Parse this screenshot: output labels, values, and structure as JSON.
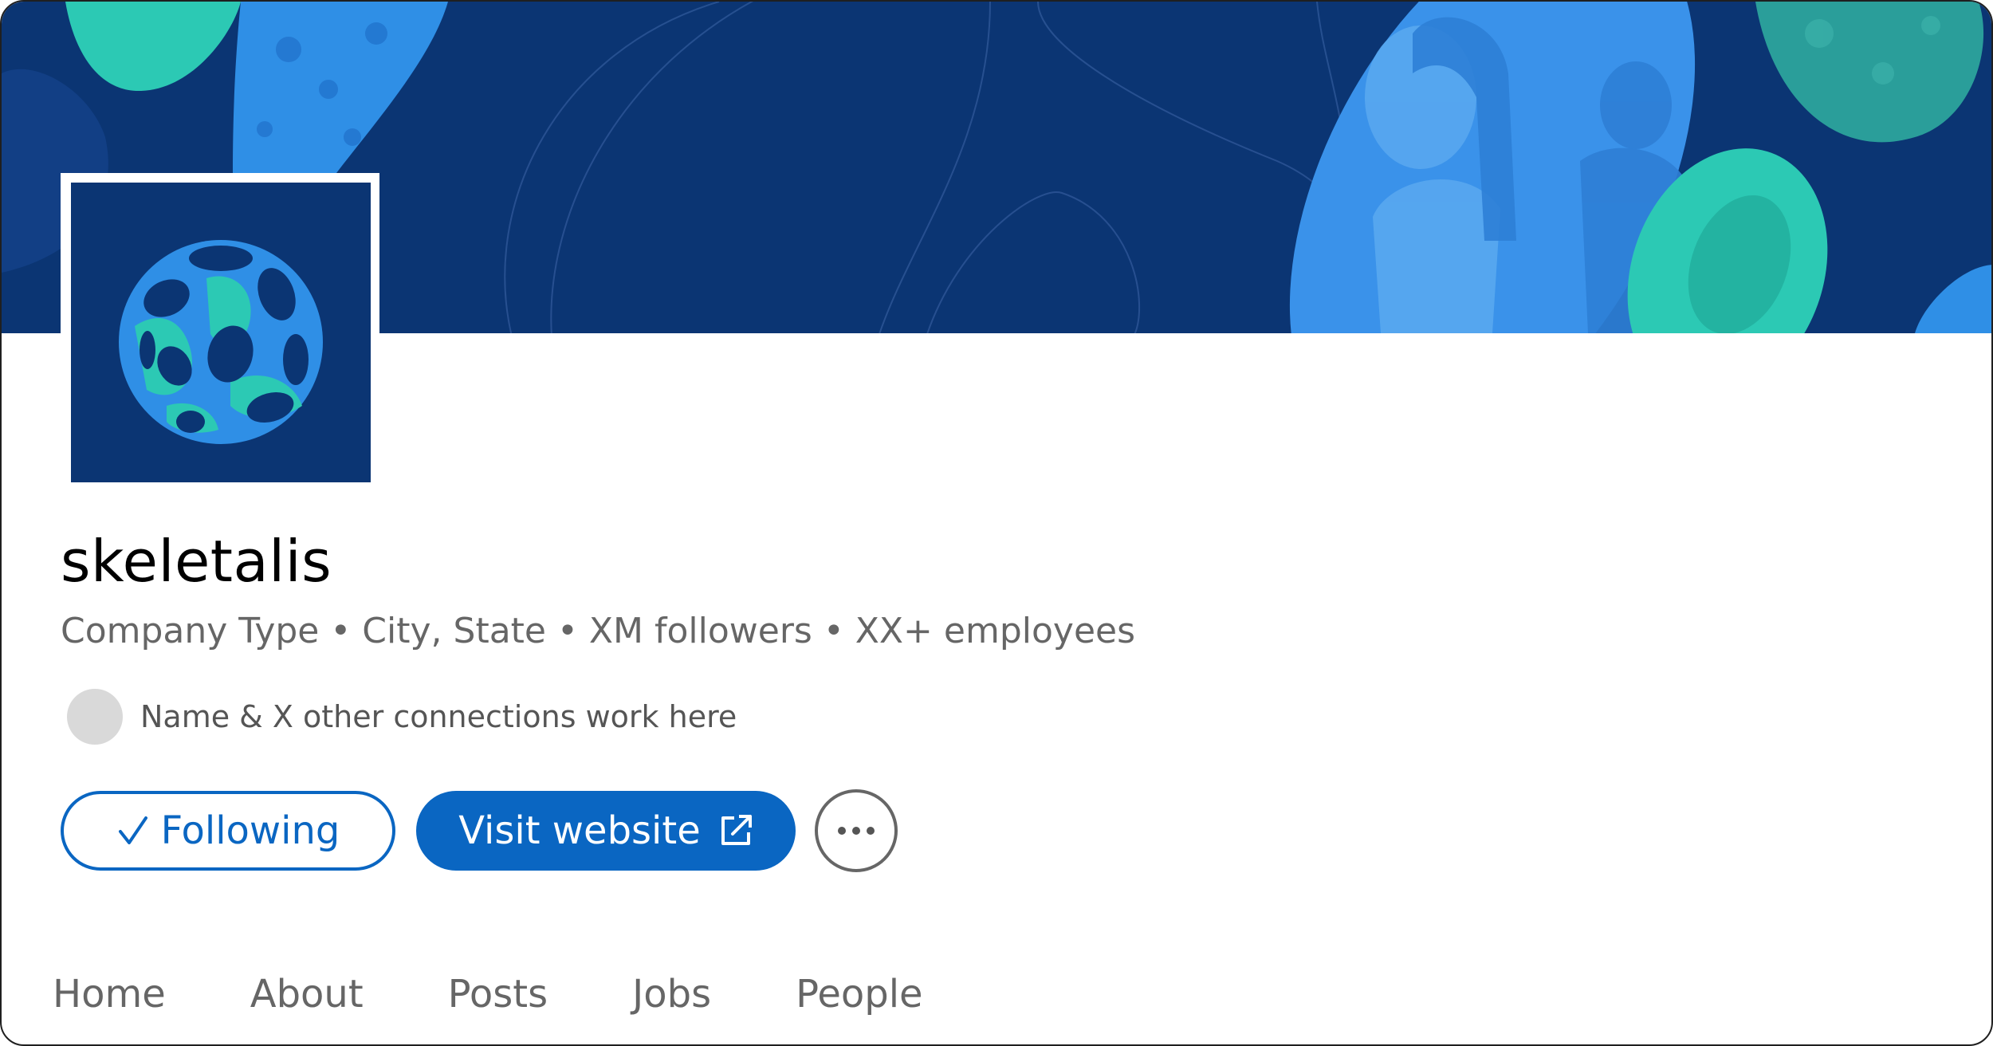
{
  "company": {
    "name": "skeletalis",
    "subtitle": "Company Type • City, State • XM followers • XX+ employees",
    "connections_text": "Name & X other connections work here"
  },
  "actions": {
    "following_label": "Following",
    "following_icon": "checkmark-icon",
    "visit_label": "Visit website",
    "visit_icon": "external-link-icon",
    "more_icon": "more-horizontal-icon"
  },
  "tabs": [
    {
      "label": "Home"
    },
    {
      "label": "About"
    },
    {
      "label": "Posts"
    },
    {
      "label": "Jobs"
    },
    {
      "label": "People"
    }
  ],
  "colors": {
    "banner_navy": "#0b3573",
    "banner_blue": "#2f8fe6",
    "banner_teal": "#2cc9b4",
    "primary_button": "#0a66c2",
    "secondary_text": "#666666"
  }
}
